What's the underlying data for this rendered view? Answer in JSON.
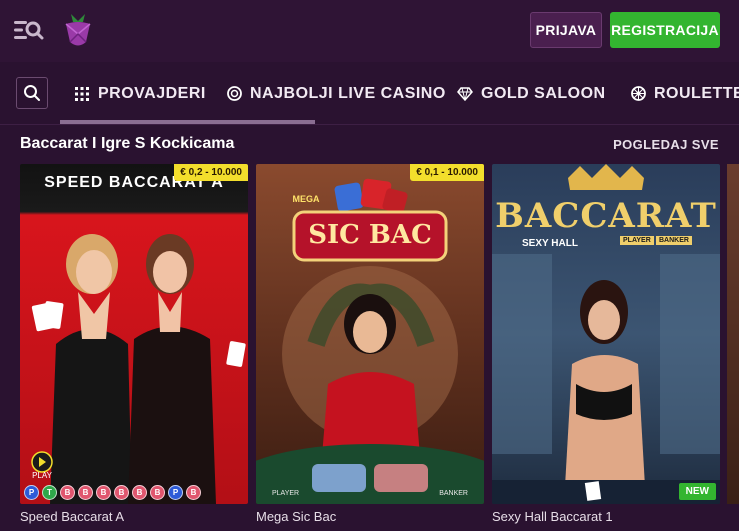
{
  "header": {
    "menu_icon": "menu-search-icon",
    "logo_icon": "raspberry-logo",
    "login_label": "PRIJAVA",
    "register_label": "REGISTRACIJA",
    "colors": {
      "register": "#33b530",
      "login": "#4a1f4f",
      "background": "#2f1435"
    }
  },
  "nav": {
    "search_icon": "search-icon",
    "tabs": [
      {
        "label": "PROVAJDERI",
        "icon": "grid-icon"
      },
      {
        "label": "NAJBOLJI LIVE CASINO",
        "icon": "chip-icon"
      },
      {
        "label": "GOLD SALOON",
        "icon": "diamond-icon"
      },
      {
        "label": "ROULETTE",
        "icon": "roulette-icon"
      }
    ]
  },
  "section": {
    "title": "Baccarat I Igre S Kockicama",
    "see_all": "POGLEDAJ SVE"
  },
  "games": [
    {
      "name": "Speed Baccarat A",
      "art_title": "SPEED BACCARAT A",
      "price": "€ 0,2 - 10.000",
      "history": [
        "P",
        "T",
        "B",
        "B",
        "B",
        "B",
        "B",
        "B",
        "P",
        "B"
      ]
    },
    {
      "name": "Mega Sic Bac",
      "art_title": "SIC BAC",
      "art_subtitle": "MEGA",
      "price": "€ 0,1 - 10.000",
      "table_left": "PLAYER",
      "table_right": "BANKER"
    },
    {
      "name": "Sexy Hall Baccarat 1",
      "art_title": "BACCARAT",
      "art_subtitle": "SEXY HALL",
      "art_player": "PLAYER",
      "art_banker": "BANKER",
      "badge": "NEW"
    }
  ],
  "chip_colors": {
    "P": "#2d5bd8",
    "T": "#2fa84a",
    "B": "#e0566e"
  }
}
